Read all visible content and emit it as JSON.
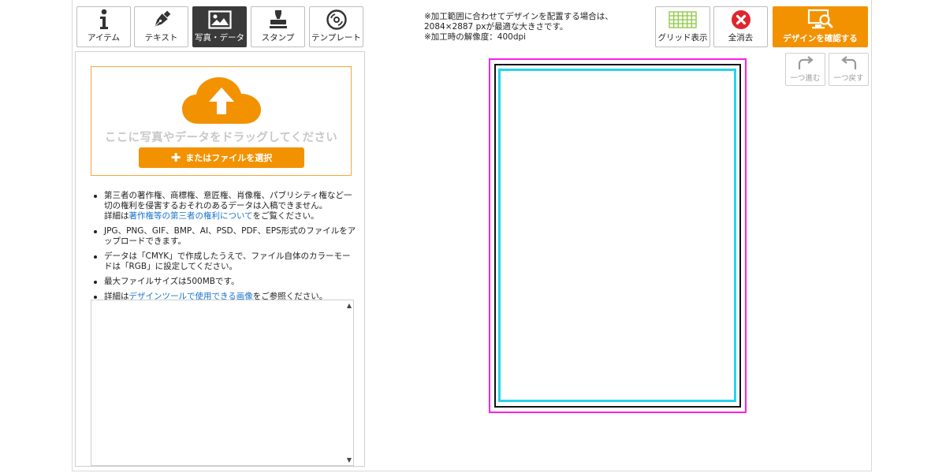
{
  "tabs": [
    {
      "label": "アイテム",
      "icon": "info-icon",
      "active": false
    },
    {
      "label": "テキスト",
      "icon": "pen-icon",
      "active": false
    },
    {
      "label": "写真・データ",
      "icon": "image-icon",
      "active": true
    },
    {
      "label": "スタンプ",
      "icon": "stamp-icon",
      "active": false
    },
    {
      "label": "テンプレート",
      "icon": "disc-icon",
      "active": false
    }
  ],
  "header": {
    "note_line1": "※加工範囲に合わせてデザインを配置する場合は、",
    "note_line2": "2084×2887 pxが最適な大きさです。",
    "note_line3": "※加工時の解像度：400dpi"
  },
  "toolbar": {
    "grid_label": "グリッド表示",
    "clear_label": "全消去",
    "confirm_label": "デザインを確認する",
    "redo_label": "一つ進む",
    "undo_label": "一つ戻す"
  },
  "upload": {
    "hint": "ここに写真やデータをドラッグしてください",
    "button_label": "またはファイルを選択"
  },
  "notes": {
    "item1_text": "第三者の著作権、商標権、意匠権、肖像権、パブリシティ権など一切の権利を侵害するおそれのあるデータは入稿できません。",
    "item1_detail_prefix": "詳細は",
    "item1_link": "著作権等の第三者の権利について",
    "item1_detail_suffix": "をご覧ください。",
    "item2_text": "JPG、PNG、GIF、BMP、AI、PSD、PDF、EPS形式のファイルをアップロードできます。",
    "item3_text": "データは「CMYK」で作成したうえで、ファイル自体のカラーモードは「RGB」に設定してください。",
    "item4_text": "最大ファイルサイズは500MBです。",
    "item5_prefix": "詳細は",
    "item5_link": "デザインツールで使用できる画像",
    "item5_suffix": "をご参照ください。"
  },
  "colors": {
    "accent": "#f39200",
    "bleed_guide": "#ff1ee6",
    "safe_guide": "#27d3ea",
    "trim_guide": "#111111",
    "clear_icon": "#e0262d",
    "grid_icon": "#8cc63f",
    "link": "#1a73c9"
  }
}
